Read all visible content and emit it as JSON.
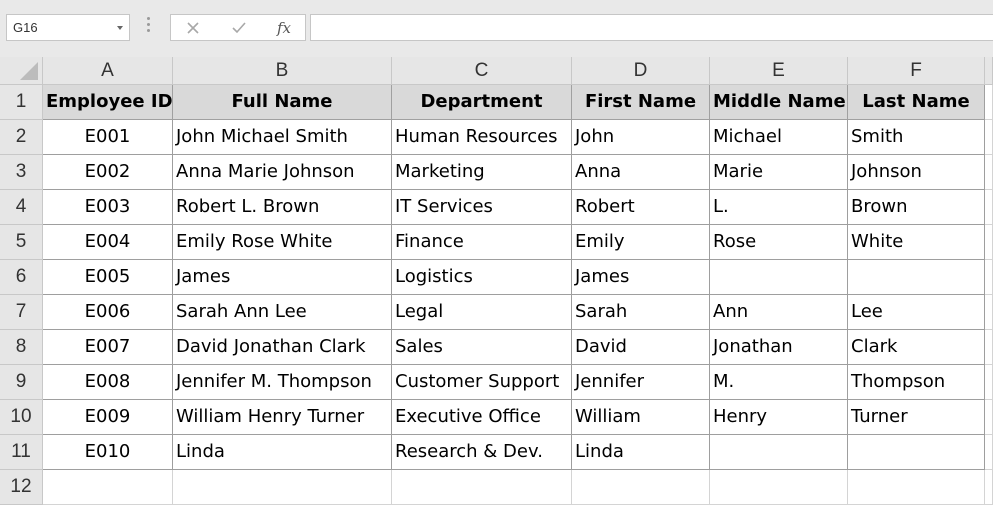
{
  "name_box": {
    "value": "G16"
  },
  "formula_bar": {
    "value": "",
    "icons": {
      "cancel": "close-icon",
      "enter": "check-icon",
      "function": "fx-icon"
    },
    "fx_label": "fx"
  },
  "columns": [
    "A",
    "B",
    "C",
    "D",
    "E",
    "F"
  ],
  "rows": [
    "1",
    "2",
    "3",
    "4",
    "5",
    "6",
    "7",
    "8",
    "9",
    "10",
    "11",
    "12"
  ],
  "table": {
    "headers": [
      "Employee ID",
      "Full Name",
      "Department",
      "First Name",
      "Middle Name",
      "Last Name"
    ],
    "data": [
      [
        "E001",
        "John Michael Smith",
        "Human Resources",
        "John",
        "Michael",
        "Smith"
      ],
      [
        "E002",
        "Anna Marie Johnson",
        "Marketing",
        "Anna",
        "Marie",
        "Johnson"
      ],
      [
        "E003",
        "Robert L. Brown",
        "IT Services",
        "Robert",
        "L.",
        "Brown"
      ],
      [
        "E004",
        "Emily Rose White",
        "Finance",
        "Emily",
        "Rose",
        "White"
      ],
      [
        "E005",
        "James",
        "Logistics",
        "James",
        "",
        ""
      ],
      [
        "E006",
        "Sarah Ann Lee",
        "Legal",
        "Sarah",
        "Ann",
        "Lee"
      ],
      [
        "E007",
        "David Jonathan Clark",
        "Sales",
        "David",
        "Jonathan",
        "Clark"
      ],
      [
        "E008",
        "Jennifer M. Thompson",
        "Customer Support",
        "Jennifer",
        "M.",
        "Thompson"
      ],
      [
        "E009",
        "William Henry Turner",
        "Executive Office",
        "William",
        "Henry",
        "Turner"
      ],
      [
        "E010",
        "Linda",
        "Research & Dev.",
        "Linda",
        "",
        ""
      ]
    ]
  },
  "colors": {
    "header_fill": "#d9d9d9",
    "grid_background": "#e6e6e6"
  }
}
